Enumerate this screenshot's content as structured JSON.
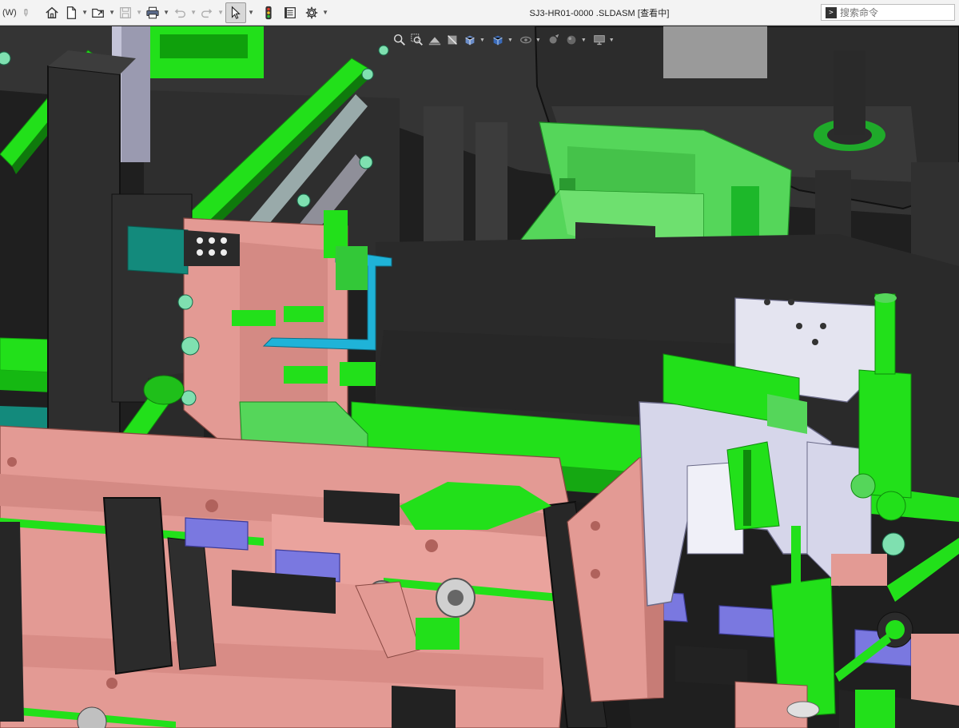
{
  "titlebar": {
    "w_label": "(W)",
    "document_title": "SJ3-HR01-0000 .SLDASM [查看中]",
    "search_placeholder": "搜索命令",
    "buttons": [
      "home-icon",
      "new-document-icon",
      "open-folder-icon",
      "save-icon",
      "print-icon",
      "undo-icon",
      "redo-icon",
      "select-arrow-icon",
      "traffic-light-icon",
      "file-properties-icon",
      "options-gear-icon"
    ]
  },
  "heads_up_toolbar": {
    "buttons": [
      "zoom-to-fit-icon",
      "zoom-area-icon",
      "previous-view-icon",
      "section-view-icon",
      "view-orientation-icon",
      "display-style-icon",
      "hide-show-icon",
      "edit-appearance-icon",
      "apply-scene-icon",
      "view-settings-icon"
    ]
  },
  "colors": {
    "bright_green": "#22e01a",
    "light_green": "#55d65a",
    "dark_body": "#2b2b2b",
    "salmon": "#e39a94",
    "lavender": "#d6d6ea",
    "periwinkle": "#7a78e0",
    "cyan": "#1fb3d8",
    "teal": "#138a7c"
  }
}
